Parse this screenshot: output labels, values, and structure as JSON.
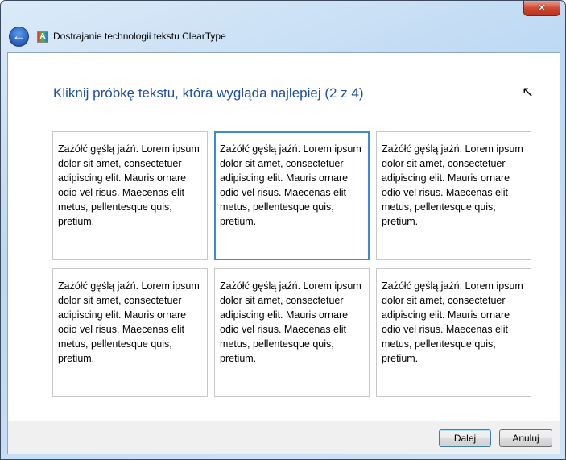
{
  "window": {
    "title": "Dostrajanie technologii tekstu ClearType",
    "close_glyph": "✕"
  },
  "heading": "Kliknij próbkę tekstu, która wygląda najlepiej (2 z 4)",
  "samples": [
    {
      "text": "Zażółć gęślą jaźń. Lorem ipsum dolor sit amet, consectetuer adipiscing elit. Mauris ornare odio vel risus. Maecenas elit metus, pellentesque quis, pretium.",
      "selected": false
    },
    {
      "text": "Zażółć gęślą jaźń. Lorem ipsum dolor sit amet, consectetuer adipiscing elit. Mauris ornare odio vel risus. Maecenas elit metus, pellentesque quis, pretium.",
      "selected": true
    },
    {
      "text": "Zażółć gęślą jaźń. Lorem ipsum dolor sit amet, consectetuer adipiscing elit. Mauris ornare odio vel risus. Maecenas elit metus, pellentesque quis, pretium.",
      "selected": false
    },
    {
      "text": "Zażółć gęślą jaźń. Lorem ipsum dolor sit amet, consectetuer adipiscing elit. Mauris ornare odio vel risus. Maecenas elit metus, pellentesque quis, pretium.",
      "selected": false
    },
    {
      "text": "Zażółć gęślą jaźń. Lorem ipsum dolor sit amet, consectetuer adipiscing elit. Mauris ornare odio vel risus. Maecenas elit metus, pellentesque quis, pretium.",
      "selected": false
    },
    {
      "text": "Zażółć gęślą jaźń. Lorem ipsum dolor sit amet, consectetuer adipiscing elit. Mauris ornare odio vel risus. Maecenas elit metus, pellentesque quis, pretium.",
      "selected": false
    }
  ],
  "buttons": {
    "next": "Dalej",
    "cancel": "Anuluj"
  },
  "colors": {
    "heading": "#1e4fa0",
    "selection": "#3f8ad8"
  }
}
